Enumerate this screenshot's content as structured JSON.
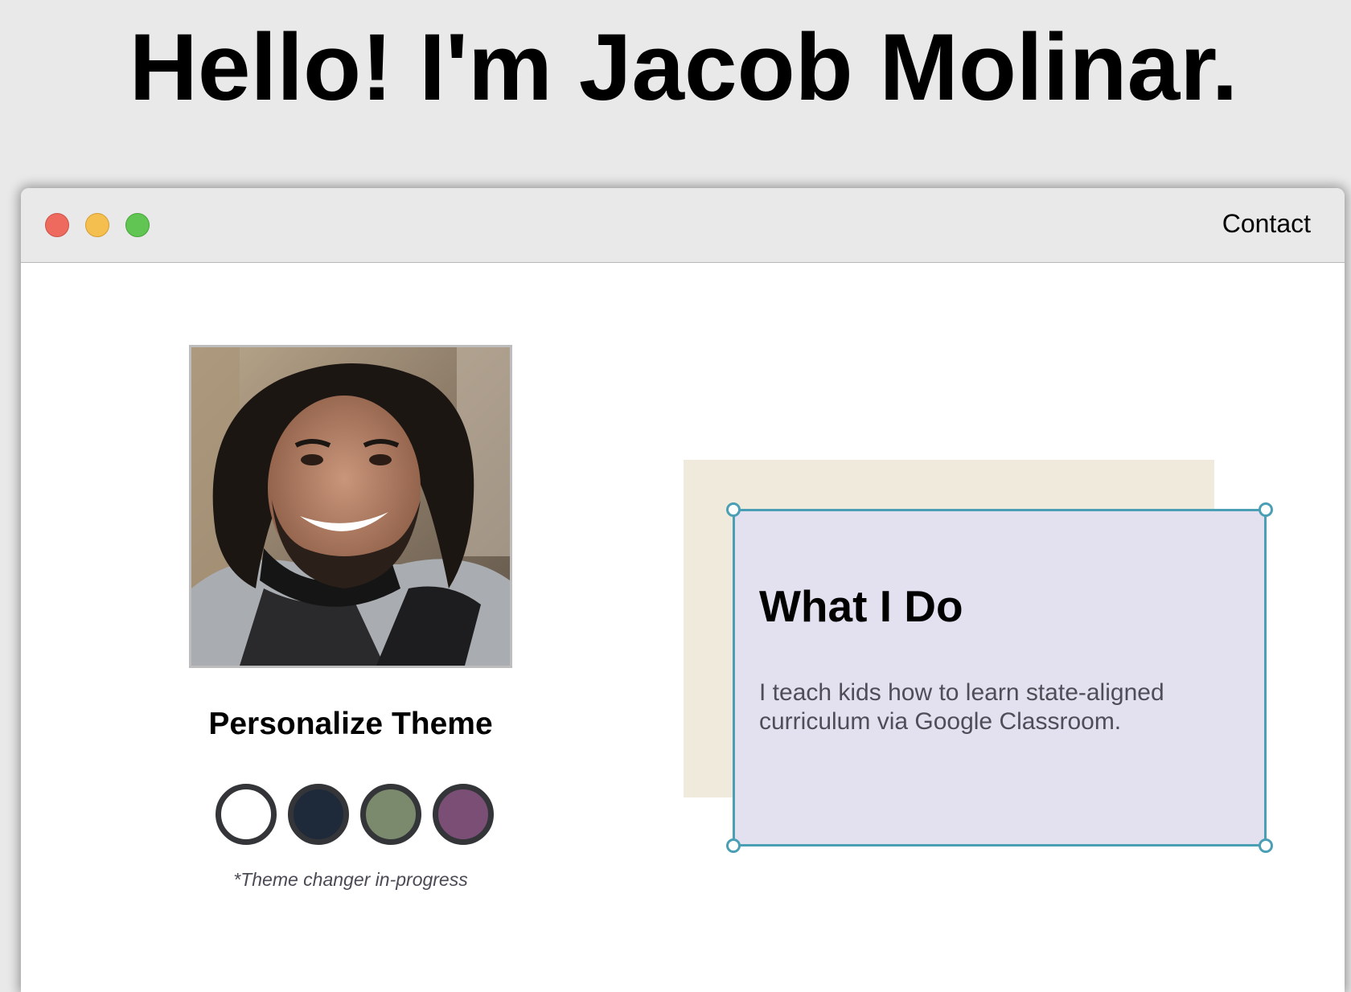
{
  "page": {
    "heading": "Hello! I'm Jacob Molinar."
  },
  "window": {
    "traffic_lights": [
      {
        "name": "close",
        "color": "#ee6a5e"
      },
      {
        "name": "minimize",
        "color": "#f5bf4f"
      },
      {
        "name": "maximize",
        "color": "#61c554"
      }
    ],
    "nav": {
      "contact_label": "Contact"
    }
  },
  "profile": {
    "photo_alt": "Portrait photo"
  },
  "theme": {
    "heading": "Personalize Theme",
    "swatches": [
      {
        "name": "white",
        "color": "#ffffff"
      },
      {
        "name": "navy",
        "color": "#1e2a3a"
      },
      {
        "name": "sage",
        "color": "#7b8a6d"
      },
      {
        "name": "plum",
        "color": "#7a4e75"
      }
    ],
    "note": "*Theme changer in-progress"
  },
  "card": {
    "title": "What I Do",
    "text": "I teach kids how to learn state-aligned curriculum via Google Classroom.",
    "back_color": "#efeadb",
    "front_color": "#e3e0ef",
    "selection_color": "#4b9fb5"
  }
}
